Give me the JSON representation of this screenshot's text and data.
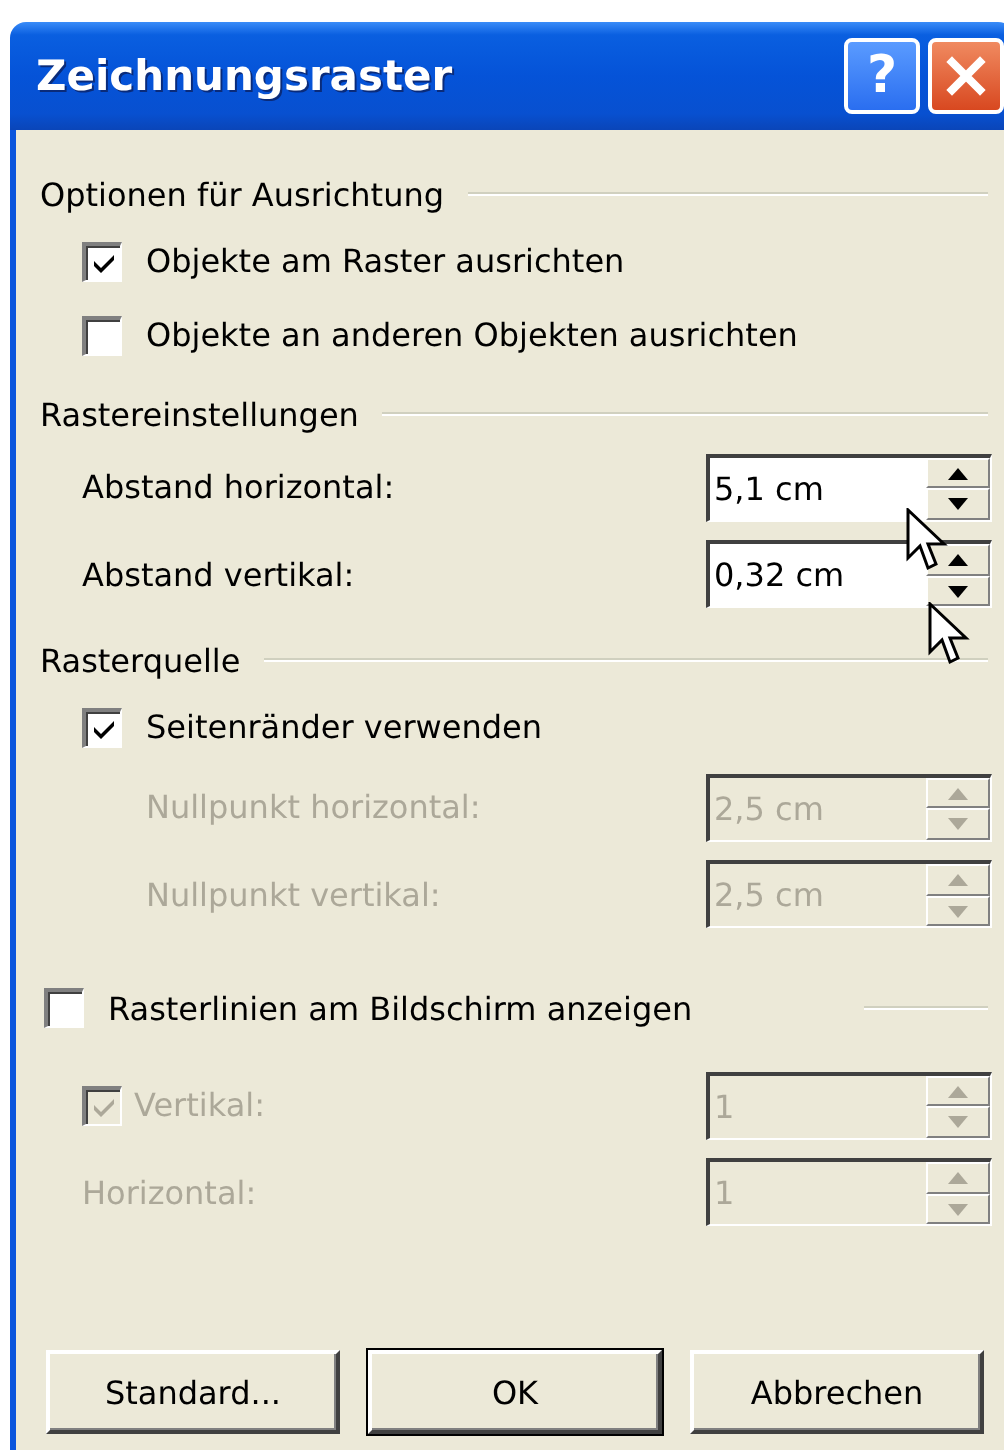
{
  "window": {
    "title": "Zeichnungsraster",
    "help_button": "?"
  },
  "sections": [
    {
      "kind": "heading",
      "heading": "Optionen für Ausrichtung",
      "items": [
        {
          "kind": "checkbox",
          "label": "Objekte am Raster ausrichten",
          "checked": true,
          "disabled": false
        },
        {
          "kind": "checkbox",
          "label": "Objekte an anderen Objekten ausrichten",
          "checked": false,
          "disabled": false
        }
      ]
    },
    {
      "kind": "heading",
      "heading": "Rastereinstellungen",
      "items": [
        {
          "kind": "spin",
          "label": "Abstand horizontal:",
          "value": "5,1 cm",
          "disabled": false
        },
        {
          "kind": "spin",
          "label": "Abstand vertikal:",
          "value": "0,32 cm",
          "disabled": false
        }
      ]
    },
    {
      "kind": "heading",
      "heading": "Rasterquelle",
      "items": [
        {
          "kind": "checkbox",
          "label": "Seitenränder verwenden",
          "checked": true,
          "disabled": false,
          "children": [
            {
              "kind": "spin",
              "label": "Nullpunkt horizontal:",
              "value": "2,5 cm",
              "disabled": true
            },
            {
              "kind": "spin",
              "label": "Nullpunkt vertikal:",
              "value": "2,5 cm",
              "disabled": true
            }
          ]
        }
      ]
    },
    {
      "kind": "checkbox_heading",
      "heading": "Rasterlinien am Bildschirm anzeigen",
      "checked": false,
      "disabled": false,
      "items": [
        {
          "kind": "check_spin",
          "label": "Vertikal:",
          "checked": true,
          "value": "1",
          "disabled": true
        },
        {
          "kind": "spin",
          "label": "Horizontal:",
          "value": "1",
          "disabled": true
        }
      ]
    }
  ],
  "buttons": [
    {
      "label": "Standard...",
      "default": false
    },
    {
      "label": "OK",
      "default": true
    },
    {
      "label": "Abbrechen",
      "default": false
    }
  ]
}
